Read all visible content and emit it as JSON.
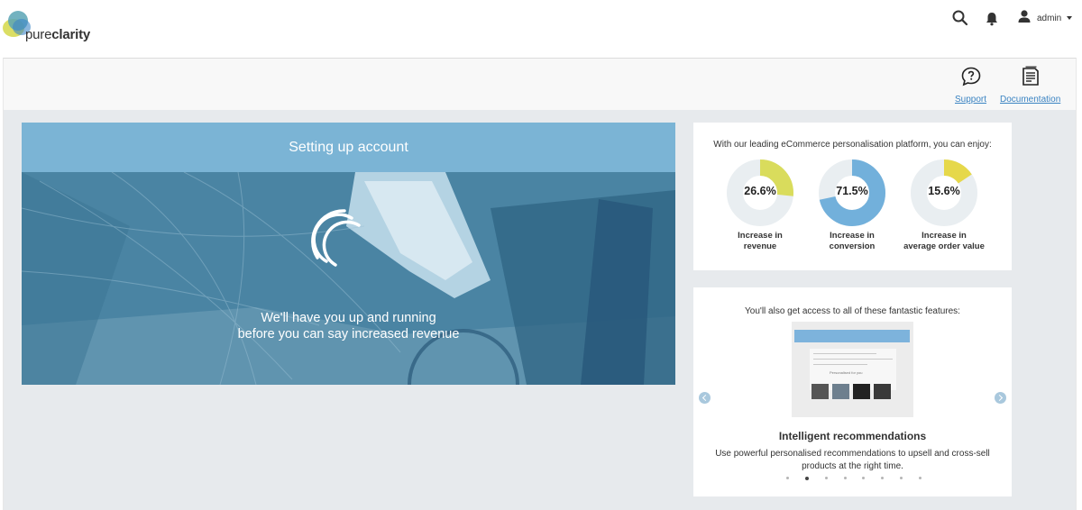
{
  "header": {
    "brand": {
      "prefix": "pure",
      "suffix": "clarity"
    },
    "search_icon": "search-icon",
    "notifications_icon": "bell-icon",
    "user": {
      "icon": "user-icon",
      "name": "admin"
    }
  },
  "helpbar": {
    "support": {
      "icon": "speech-question-icon",
      "label": "Support"
    },
    "documentation": {
      "icon": "document-icon",
      "label": "Documentation"
    }
  },
  "hero": {
    "title": "Setting up account",
    "message_line1": "We'll have you up and running",
    "message_line2": "before you can say increased revenue",
    "loading_icon": "loading-spinner-icon"
  },
  "stats": {
    "intro": "With our leading eCommerce personalisation platform, you can enjoy:",
    "items": [
      {
        "value": "26.6%",
        "percent": 26.6,
        "label_line1": "Increase in",
        "label_line2": "revenue",
        "color": "#d9dc5c"
      },
      {
        "value": "71.5%",
        "percent": 71.5,
        "label_line1": "Increase in",
        "label_line2": "conversion",
        "color": "#72b0db"
      },
      {
        "value": "15.6%",
        "percent": 15.6,
        "label_line1": "Increase in",
        "label_line2": "average order value",
        "color": "#e6d84a"
      }
    ]
  },
  "features": {
    "intro": "You'll also get access to all of these fantastic features:",
    "image_caption": "Personalised for you",
    "title": "Intelligent recommendations",
    "description": "Use powerful personalised recommendations to upsell and cross-sell products at the right time.",
    "carousel_count": 8,
    "carousel_active": 1,
    "prev_icon": "chevron-left-icon",
    "next_icon": "chevron-right-icon"
  },
  "colors": {
    "accent": "#3a83c2",
    "hero_header": "#7bb4d5",
    "hero_body": "#4a87a8",
    "background": "#e7eaed"
  }
}
